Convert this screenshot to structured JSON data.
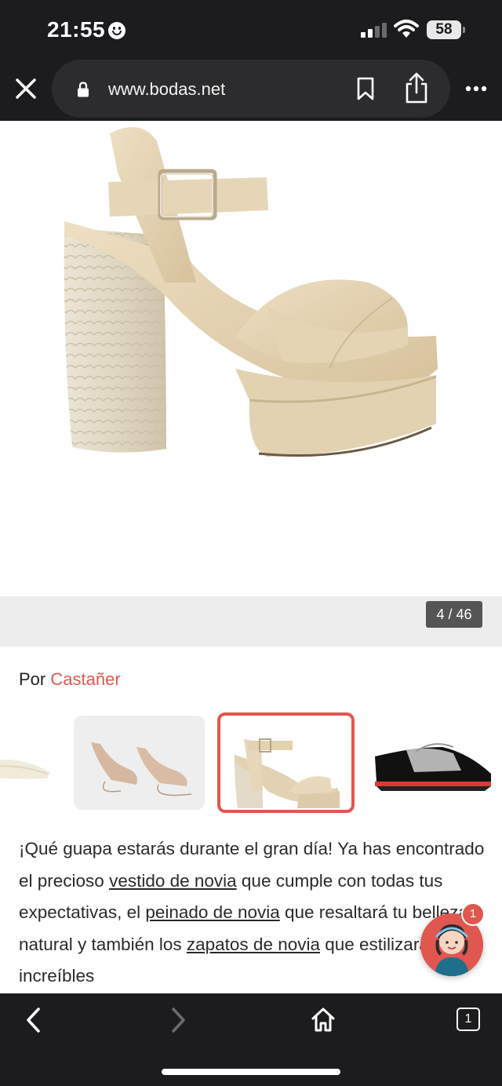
{
  "status_bar": {
    "time": "21:55",
    "battery": "58"
  },
  "browser": {
    "url": "www.bodas.net"
  },
  "gallery": {
    "counter": "4 / 46"
  },
  "byline": {
    "prefix": "Por",
    "author": "Castañer"
  },
  "article": {
    "t1": "¡Qué guapa estarás durante el gran día! Ya has encontrado el precioso ",
    "l1": "vestido de novia",
    "t2": " que cumple con todas tus expectativas, el ",
    "l2": "peinado de novia",
    "t3": " que resaltará tu belleza natural y también los ",
    "l3": "zapatos de novia",
    "t4": " que estilizarán tus increíbles"
  },
  "chat": {
    "badge": "1"
  },
  "toolbar": {
    "tab_count": "1"
  },
  "colors": {
    "accent": "#e0574f",
    "chrome": "#1c1c1e",
    "url_pill": "#2c2c2e"
  }
}
